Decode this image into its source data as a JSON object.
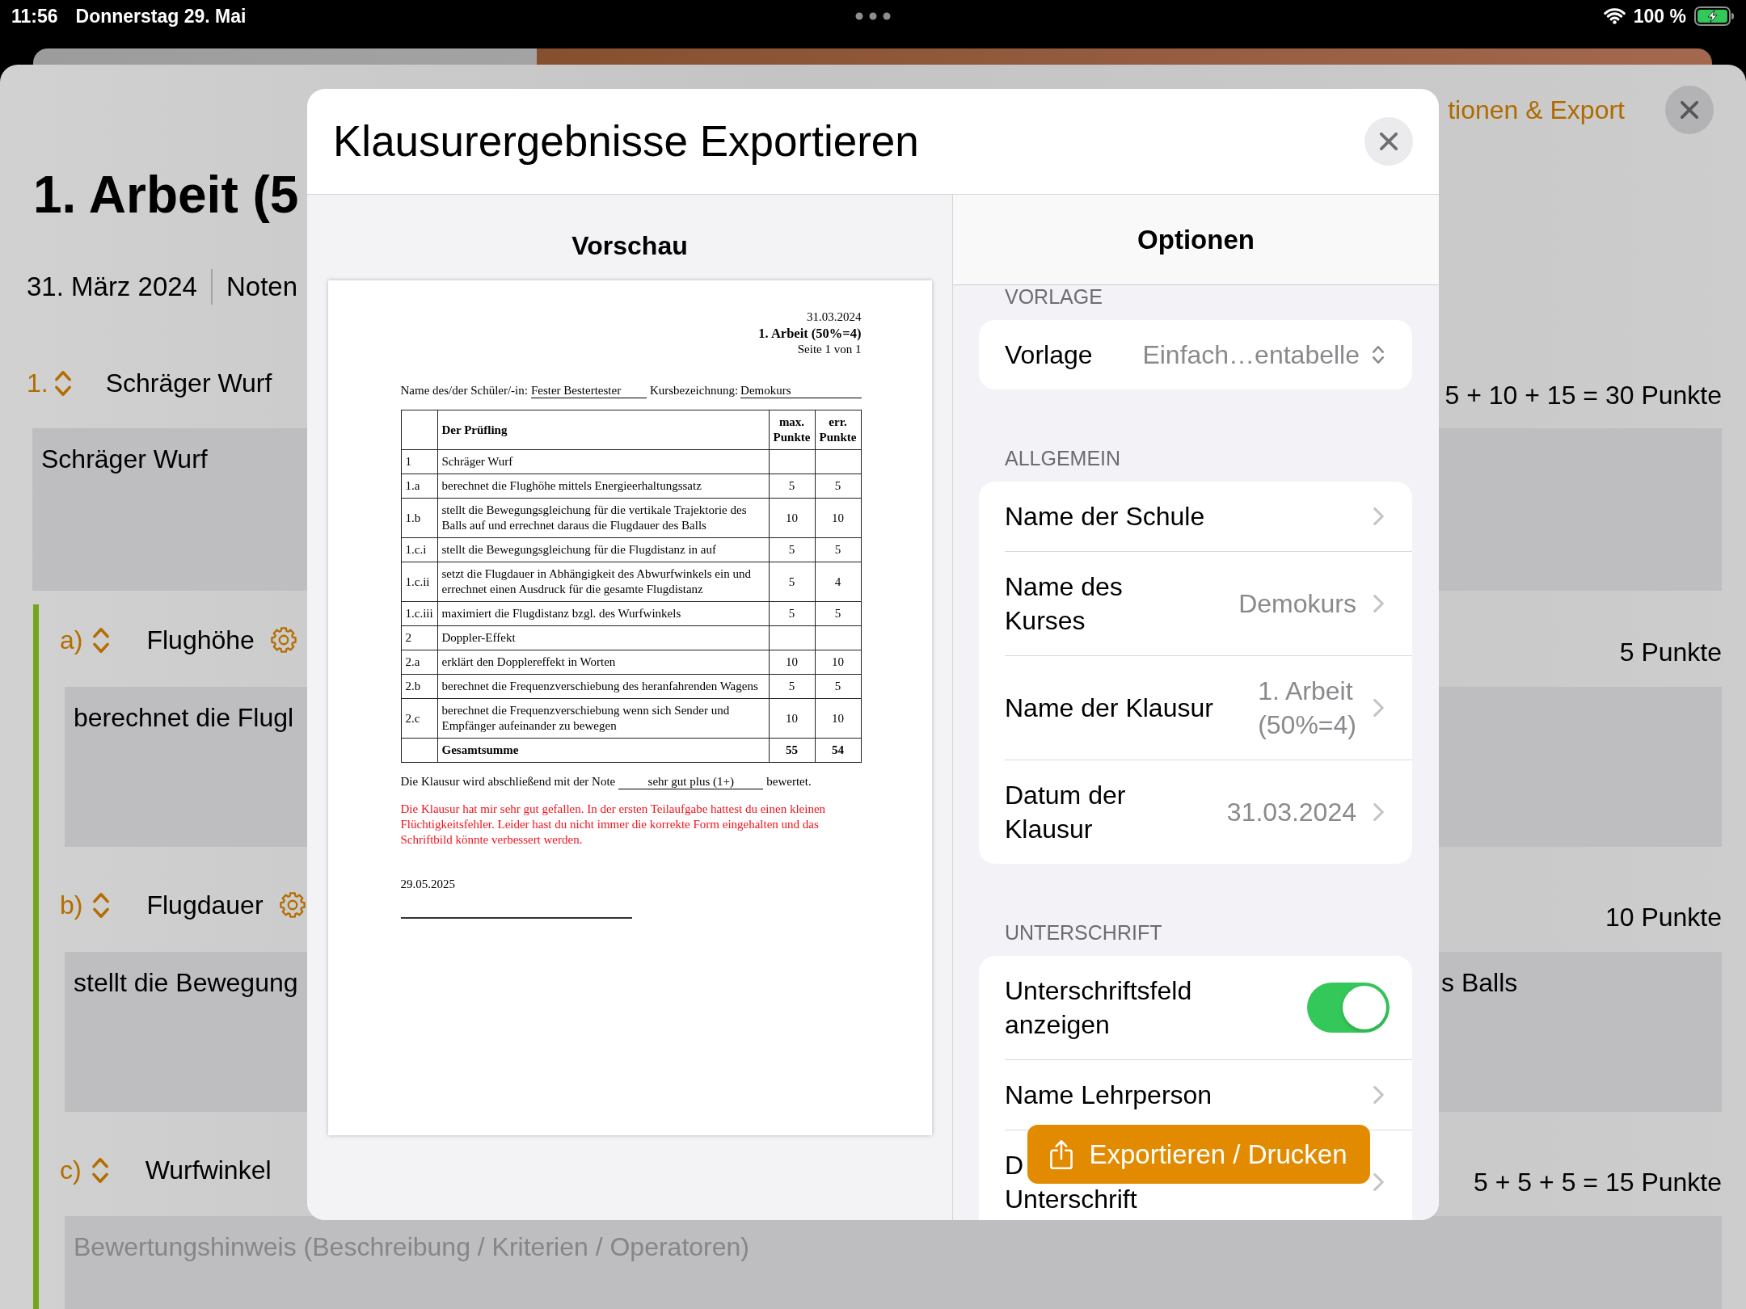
{
  "status_bar": {
    "time": "11:56",
    "date": "Donnerstag 29. Mai",
    "battery": "100 %"
  },
  "sheet": {
    "link": "tionen & Export",
    "title": "1. Arbeit (5",
    "date": "31. März 2024",
    "tab": "Noten",
    "tasks": [
      {
        "number": "1.",
        "title": "Schräger Wurf",
        "points": "5 + 10 + 15 = 30 Punkte",
        "description": "Schräger Wurf",
        "children": [
          {
            "number": "a)",
            "title": "Flughöhe",
            "settings_icon": true,
            "points": "5 Punkte",
            "description": "berechnet die Flugl"
          },
          {
            "number": "b)",
            "title": "Flugdauer",
            "settings_icon": true,
            "points": "10 Punkte",
            "description": "stellt die Bewegung",
            "description_end": "s Balls"
          },
          {
            "number": "c)",
            "title": "Wurfwinkel",
            "points": "5 + 5 + 5 = 15 Punkte",
            "placeholder": "Bewertungshinweis (Beschreibung / Kriterien / Operatoren)"
          }
        ]
      }
    ]
  },
  "dialog": {
    "title": "Klausurergebnisse Exportieren",
    "preview": {
      "heading": "Vorschau",
      "document": {
        "date": "31.03.2024",
        "title": "1. Arbeit (50%=4)",
        "page": "Seite 1 von 1",
        "student_label": "Name des/der Schüler/-in:",
        "student": "Fester Bestertester",
        "course_label": "Kursbezeichnung:",
        "course": "Demokurs",
        "columns": [
          "Der Prüfling",
          "max. Punkte",
          "err. Punkte"
        ],
        "rows": [
          {
            "number": "1",
            "text": "Schräger Wurf"
          },
          {
            "number": "1.a",
            "text": "berechnet die Flughöhe mittels Energieerhaltungssatz",
            "max": "5",
            "achieved": "5"
          },
          {
            "number": "1.b",
            "text": "stellt die Bewegungsgleichung für die vertikale Trajektorie des Balls auf und errechnet daraus die Flugdauer des Balls",
            "max": "10",
            "achieved": "10"
          },
          {
            "number": "1.c.i",
            "text": "stellt die Bewegungsgleichung für die Flugdistanz in auf",
            "max": "5",
            "achieved": "5"
          },
          {
            "number": "1.c.ii",
            "text": "setzt die Flugdauer in Abhängigkeit des Abwurfwinkels ein und errechnet einen Ausdruck für die gesamte Flugdistanz",
            "max": "5",
            "achieved": "4"
          },
          {
            "number": "1.c.iii",
            "text": "maximiert die Flugdistanz bzgl. des Wurfwinkels",
            "max": "5",
            "achieved": "5"
          },
          {
            "number": "2",
            "text": "Doppler-Effekt"
          },
          {
            "number": "2.a",
            "text": "erklärt den Dopplereffekt in Worten",
            "max": "10",
            "achieved": "10"
          },
          {
            "number": "2.b",
            "text": "berechnet die Frequenzverschiebung des heranfahrenden Wagens",
            "max": "5",
            "achieved": "5"
          },
          {
            "number": "2.c",
            "text": "berechnet die Frequenzverschiebung wenn sich Sender und Empfänger aufeinander zu bewegen",
            "max": "10",
            "achieved": "10"
          }
        ],
        "total": {
          "label": "Gesamtsumme",
          "max": "55",
          "achieved": "54"
        },
        "grade_label": "Die Klausur wird abschließend mit der Note",
        "grade": "sehr gut plus (1+)",
        "grade_suffix": "bewertet.",
        "comment": "Die Klausur hat mir sehr gut gefallen. In der ersten Teilaufgabe hattest du einen kleinen Flüchtigkeitsfehler. Leider hast du nicht immer die korrekte Form eingehalten und das Schriftbild könnte verbessert werden.",
        "signature_date": "29.05.2025"
      }
    },
    "options": {
      "heading": "Optionen",
      "sections": [
        {
          "header": "VORLAGE",
          "rows": [
            {
              "kind": "picker",
              "label": "Vorlage",
              "value": "Einfach…entabelle"
            }
          ]
        },
        {
          "header": "ALLGEMEIN",
          "rows": [
            {
              "kind": "link",
              "label": "Name der Schule"
            },
            {
              "kind": "link",
              "label": "Name des Kurses",
              "value": "Demokurs"
            },
            {
              "kind": "link",
              "label": "Name der Klausur",
              "value": "1. Arbeit (50%=4)"
            },
            {
              "kind": "link",
              "label": "Datum der Klausur",
              "value": "31.03.2024"
            }
          ]
        },
        {
          "header": "UNTERSCHRIFT",
          "rows": [
            {
              "kind": "toggle",
              "label": "Unterschriftsfeld anzeigen",
              "on": true
            },
            {
              "kind": "link",
              "label": "Name Lehrperson"
            },
            {
              "kind": "link",
              "label_parts": [
                "D",
                "Unterschrift"
              ]
            }
          ]
        }
      ]
    },
    "export_button": "Exportieren / Drucken"
  }
}
